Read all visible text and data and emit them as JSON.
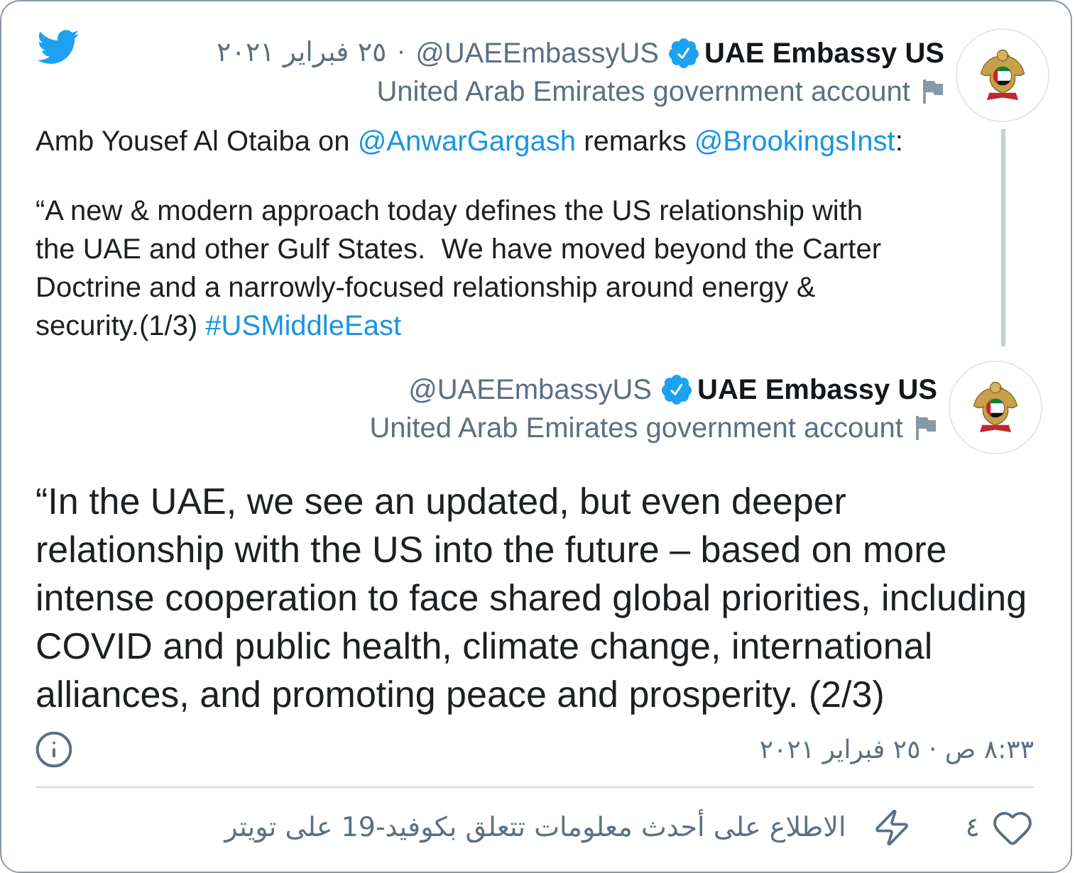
{
  "parent": {
    "author": {
      "name": "UAE Embassy US",
      "verified": true,
      "handle": "@UAEEmbassyUS",
      "label": "United Arab Emirates government account"
    },
    "separator": "·",
    "date": "٢٥ فبراير ٢٠٢١",
    "paragraphs": [
      [
        {
          "kind": "text",
          "text": "Amb Yousef Al Otaiba on "
        },
        {
          "kind": "mention",
          "text": "@AnwarGargash"
        },
        {
          "kind": "text",
          "text": " remarks "
        },
        {
          "kind": "mention",
          "text": "@BrookingsInst"
        },
        {
          "kind": "text",
          "text": ":"
        }
      ],
      [
        {
          "kind": "text",
          "text": "“A new & modern approach today defines the US relationship with the UAE and other Gulf States.  We have moved beyond the Carter Doctrine and a narrowly-focused relationship around energy & security.(1/3) "
        },
        {
          "kind": "hashtag",
          "text": "#USMiddleEast"
        }
      ]
    ]
  },
  "tweet": {
    "author": {
      "name": "UAE Embassy US",
      "verified": true,
      "handle": "@UAEEmbassyUS",
      "label": "United Arab Emirates government account"
    },
    "text": "“In the UAE, we see an updated, but even deeper relationship with the US into the future – based on more intense cooperation to face shared global priorities, including COVID and public health, climate change, international alliances, and promoting peace and prosperity. (2/3)",
    "timestamp": "٨:٣٣ ص · ٢٥ فبراير ٢٠٢١"
  },
  "actions": {
    "like_count": "٤",
    "covid_info": "الاطلاع على أحدث معلومات تتعلق بكوفيد-19 على تويتر"
  }
}
